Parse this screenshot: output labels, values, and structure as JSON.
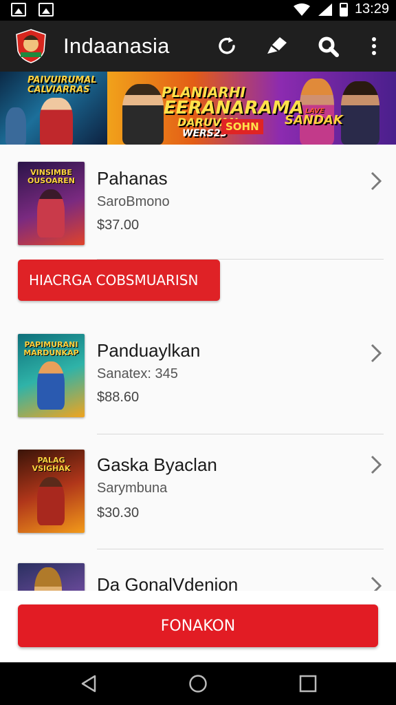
{
  "status_bar": {
    "time": "13:29"
  },
  "app_bar": {
    "title": "Indaanasia"
  },
  "banner": {
    "left_text": "PAIVUIRUMAL CALVIARRAS",
    "line1": "PLANIARHI",
    "line2": "EERANARAMA",
    "line3": "DARUVAN",
    "line4": "WERS23",
    "badge": "SOHN",
    "right_small": "LAVE",
    "right_text": "SANDAK"
  },
  "items": [
    {
      "title": "Pahanas",
      "subtitle": "SaroBmono",
      "price": "$37.00",
      "thumb_text": "VINSIMBE OUSOAREN",
      "thumb_colors": [
        "#2a1448",
        "#7a2a80",
        "#e0432b"
      ]
    },
    {
      "title": "Panduaylkan",
      "subtitle": "Sanatex: 345",
      "price": "$88.60",
      "thumb_text": "PAPIMURANI MARDUNKAP",
      "thumb_colors": [
        "#0e6f7a",
        "#2fb3a8",
        "#f0a41f"
      ]
    },
    {
      "title": "Gaska Byaclan",
      "subtitle": "Sarymbuna",
      "price": "$30.30",
      "thumb_text": "PALAG VSIGHAK",
      "thumb_colors": [
        "#3a1408",
        "#b0361a",
        "#f29a1a"
      ]
    },
    {
      "title": "Da GonalVdenion",
      "subtitle": "",
      "price": "",
      "thumb_text": "",
      "thumb_colors": [
        "#2a3060",
        "#6a4a9a",
        "#c08a3a"
      ]
    }
  ],
  "promo_tag": {
    "label": "HIACRGA COBSMUARISN"
  },
  "cta": {
    "label": "FONAKON"
  },
  "colors": {
    "accent": "#e21c24",
    "app_bar": "#1f1f1f"
  }
}
